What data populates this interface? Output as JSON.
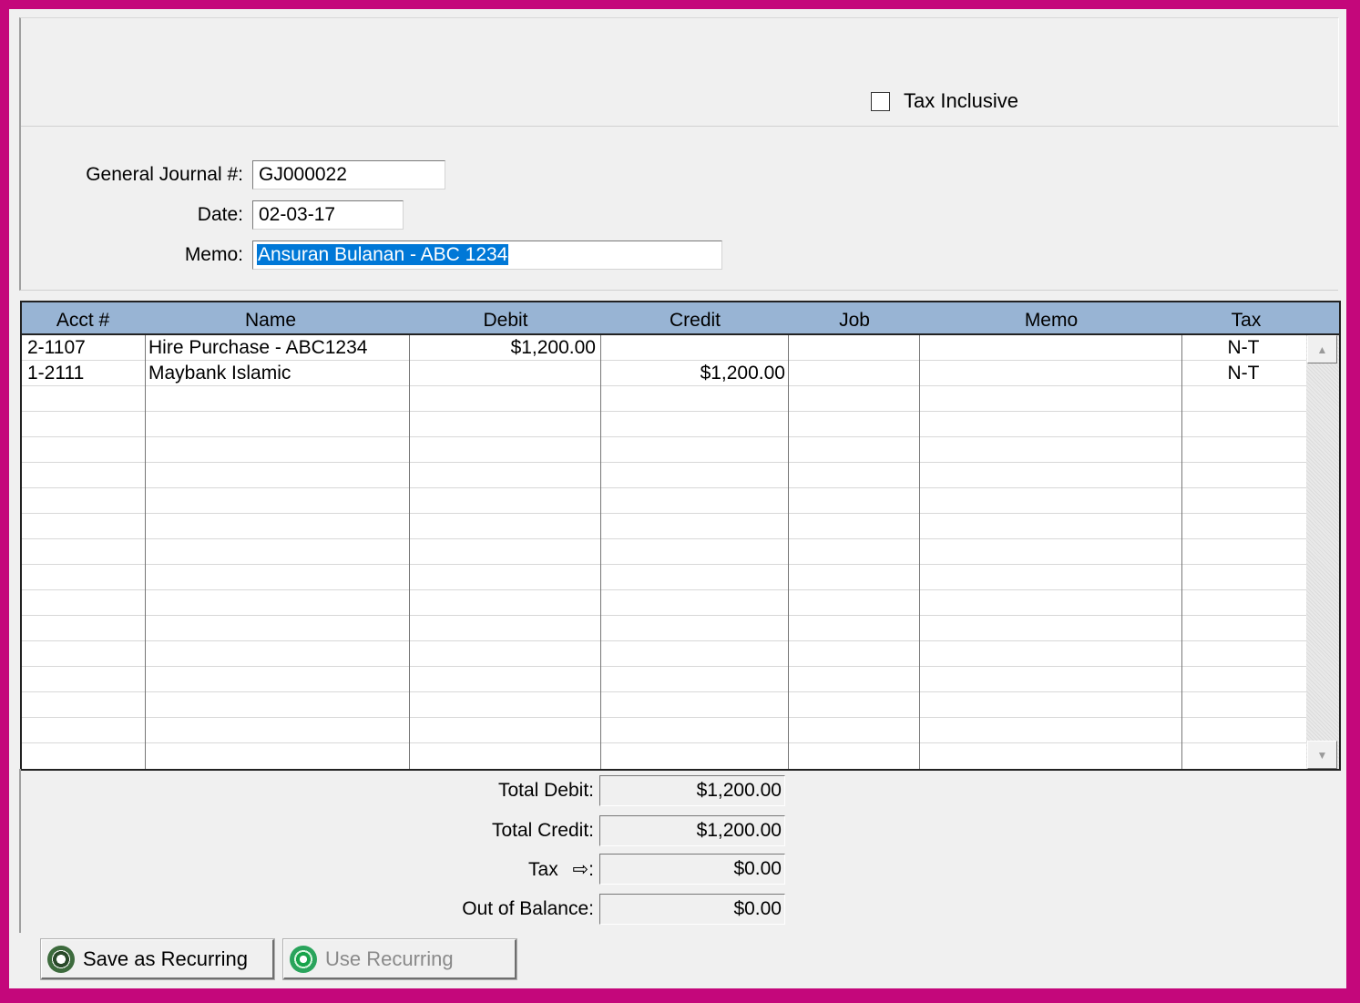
{
  "header": {
    "tax_inclusive_label": "Tax Inclusive",
    "tax_inclusive_checked": false
  },
  "form": {
    "journal_label": "General Journal #:",
    "journal_value": "GJ000022",
    "date_label": "Date:",
    "date_value": "02-03-17",
    "memo_label": "Memo:",
    "memo_value": "Ansuran Bulanan - ABC 1234"
  },
  "grid": {
    "columns": [
      "Acct #",
      "Name",
      "Debit",
      "Credit",
      "Job",
      "Memo",
      "Tax"
    ],
    "rows": [
      {
        "acct": "2-1107",
        "name": "Hire Purchase - ABC1234",
        "debit": "$1,200.00",
        "credit": "",
        "job": "",
        "memo": "",
        "tax": "N-T"
      },
      {
        "acct": "1-2111",
        "name": "Maybank Islamic",
        "debit": "",
        "credit": "$1,200.00",
        "job": "",
        "memo": "",
        "tax": "N-T"
      }
    ]
  },
  "totals": {
    "total_debit_label": "Total Debit:",
    "total_debit": "$1,200.00",
    "total_credit_label": "Total Credit:",
    "total_credit": "$1,200.00",
    "tax_label": "Tax",
    "tax_arrow": "⇨",
    "tax_colon": ":",
    "tax": "$0.00",
    "out_of_balance_label": "Out of Balance:",
    "out_of_balance": "$0.00"
  },
  "buttons": {
    "save_recurring": "Save as Recurring",
    "use_recurring": "Use Recurring"
  },
  "icons": {
    "save_recurring": "recurring-save-icon",
    "use_recurring": "recurring-use-icon",
    "scroll_up": "scroll-up-arrow-icon",
    "scroll_down": "scroll-down-arrow-icon",
    "tax_arrow": "tax-arrow-icon"
  },
  "colors": {
    "frame": "#c4077b",
    "grid_header": "#98b4d4",
    "selection": "#0078d7"
  }
}
